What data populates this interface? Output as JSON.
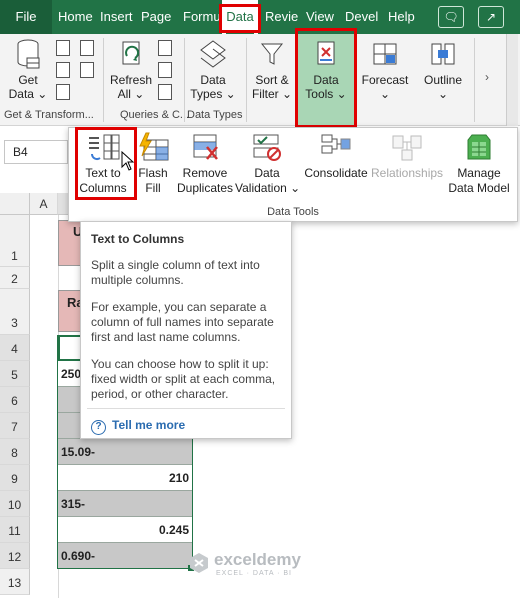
{
  "tabs": [
    "File",
    "Home",
    "Insert",
    "Page",
    "Formu",
    "Data",
    "Revie",
    "View",
    "Devel",
    "Help"
  ],
  "ribbon": {
    "get_data": "Get\nData ⌄",
    "refresh_all": "Refresh\nAll ⌄",
    "data_types": "Data\nTypes ⌄",
    "sort_filter": "Sort &\nFilter ⌄",
    "data_tools": "Data\nTools ⌄",
    "forecast": "Forecast\n⌄",
    "outline": "Outline\n⌄",
    "groups": {
      "get_transform": "Get & Transform...",
      "queries": "Queries & C...",
      "data_types": "Data Types"
    }
  },
  "name_box": "B4",
  "data_tools_panel": {
    "text_to_columns": "Text to\nColumns",
    "flash_fill": "Flash\nFill",
    "remove_duplicates": "Remove\nDuplicates",
    "data_validation": "Data\nValidation ⌄",
    "consolidate": "Consolidate",
    "relationships": "Relationships",
    "manage_data_model": "Manage\nData Model",
    "group_label": "Data Tools"
  },
  "tooltip": {
    "title": "Text to Columns",
    "para1": "Split a single column of text into multiple columns.",
    "para2": "For example, you can separate a column of full names into separate first and last name columns.",
    "para3": "You can choose how to split it up: fixed width or split at each comma, period, or other character.",
    "more": "Tell me more"
  },
  "grid": {
    "col_a": "A",
    "rows": [
      "1",
      "2",
      "3",
      "4",
      "5",
      "6",
      "7",
      "8",
      "9",
      "10",
      "11",
      "12",
      "13"
    ],
    "header_partial_1": "U",
    "header_partial_3": "Ra",
    "cells": {
      "r5": "250",
      "r8": "15.09-",
      "r9": "210",
      "r10": "315-",
      "r11": "0.245",
      "r12": "0.690-"
    }
  },
  "watermark": {
    "name": "exceldemy",
    "tagline": "EXCEL · DATA · BI"
  },
  "colors": {
    "excel_green": "#217346",
    "highlight_red": "#e00000",
    "header_pink": "#e5b8b7",
    "cell_grey": "#c8c8c8",
    "selected_green": "#a9d6b5"
  }
}
